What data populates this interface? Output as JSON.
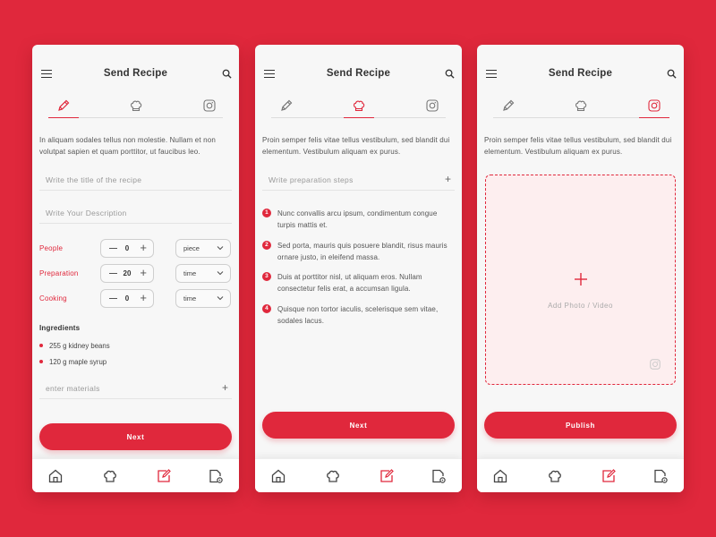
{
  "colors": {
    "accent": "#e0283c",
    "background": "#e0283c",
    "card": "#f7f7f7",
    "text": "#333333"
  },
  "icons": [
    "menu-icon",
    "search-icon",
    "pencil-icon",
    "chef-hat-icon",
    "instagram-icon",
    "home-icon",
    "edit-icon",
    "document-settings-icon",
    "plus-icon",
    "chevron-down-icon"
  ],
  "header": {
    "title": "Send Recipe"
  },
  "screen1": {
    "intro": "In aliquam sodales tellus non molestie. Nullam et non volutpat sapien et quam porttitor, ut faucibus leo.",
    "title_placeholder": "Write the title of the recipe",
    "description_placeholder": "Write Your Description",
    "rows": [
      {
        "label": "People",
        "value": "0",
        "unit": "piece"
      },
      {
        "label": "Preparation",
        "value": "20",
        "unit": "time"
      },
      {
        "label": "Cooking",
        "value": "0",
        "unit": "time"
      }
    ],
    "ingredients_heading": "Ingredients",
    "ingredients": [
      "255 g kidney beans",
      "120 g maple syrup"
    ],
    "materials_placeholder": "enter materials",
    "button": "Next"
  },
  "screen2": {
    "intro": "Proin semper felis vitae tellus vestibulum, sed blandit dui elementum. Vestibulum aliquam ex purus.",
    "steps_placeholder": "Write preparation steps",
    "steps": [
      {
        "num": "1",
        "text": "Nunc convallis arcu ipsum, condimentum congue turpis mattis et."
      },
      {
        "num": "2",
        "text": "Sed porta, mauris quis posuere blandit, risus mauris ornare justo, in eleifend massa."
      },
      {
        "num": "3",
        "text": "Duis at porttitor nisl, ut aliquam eros. Nullam consectetur felis erat, a accumsan ligula."
      },
      {
        "num": "4",
        "text": "Quisque non tortor iaculis, scelerisque sem vitae, sodales lacus."
      }
    ],
    "button": "Next"
  },
  "screen3": {
    "intro": "Proin semper felis vitae tellus vestibulum, sed blandit dui elementum. Vestibulum aliquam ex purus.",
    "upload_label": "Add Photo / Video",
    "button": "Publish"
  }
}
